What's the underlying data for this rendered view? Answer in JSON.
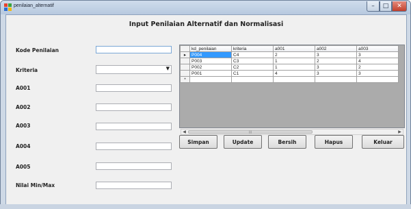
{
  "window": {
    "title": "penilaian_alternatif",
    "minimize_icon": "minimize-icon",
    "maximize_icon": "maximize-icon",
    "close_icon": "close-icon",
    "close_color": "#c7402c"
  },
  "form": {
    "heading": "Input Penilaian Alternatif dan Normalisasi",
    "fields": [
      {
        "label": "Kode Penilaian",
        "value": ""
      },
      {
        "label": "Kriteria",
        "value": ""
      },
      {
        "label": "A001",
        "value": ""
      },
      {
        "label": "A002",
        "value": ""
      },
      {
        "label": "A003",
        "value": ""
      },
      {
        "label": "A004",
        "value": ""
      },
      {
        "label": "A005",
        "value": ""
      },
      {
        "label": "Nilai Min/Max",
        "value": ""
      }
    ]
  },
  "grid": {
    "columns": [
      "kd_penilaian",
      "kriteria",
      "a001",
      "a002",
      "a003"
    ],
    "rows": [
      [
        "P004",
        "C4",
        "2",
        "3",
        "3"
      ],
      [
        "P003",
        "C3",
        "1",
        "2",
        "4"
      ],
      [
        "P002",
        "C2",
        "1",
        "3",
        "2"
      ],
      [
        "P001",
        "C1",
        "4",
        "3",
        "3"
      ]
    ],
    "current_row_marker": "▸",
    "new_row_marker": "*",
    "selection_color": "#3399ff"
  },
  "buttons": {
    "simpan": "Simpan",
    "update": "Update",
    "bersih": "Bersih",
    "hapus": "Hapus",
    "keluar": "Keluar"
  }
}
